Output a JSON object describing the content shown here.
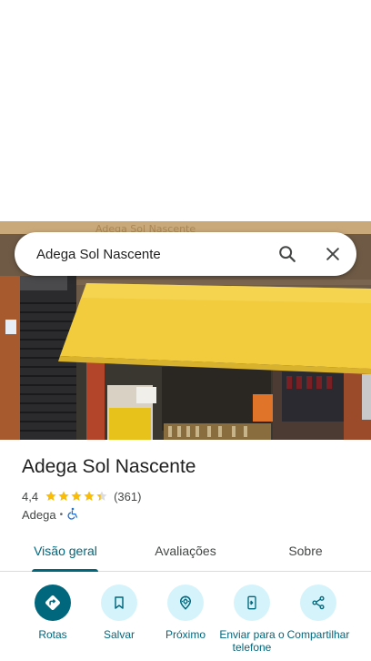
{
  "search": {
    "query": "Adega Sol Nascente"
  },
  "place": {
    "name": "Adega Sol Nascente",
    "rating": "4,4",
    "rating_value": 4.4,
    "rating_max": 5,
    "review_count": "(361)",
    "category": "Adega",
    "separator": "•",
    "accessibility_icon": "wheelchair-icon",
    "photo_sign_text": "Adega Sol Nascente"
  },
  "tabs": [
    {
      "label": "Visão geral",
      "active": true
    },
    {
      "label": "Avaliações",
      "active": false
    },
    {
      "label": "Sobre",
      "active": false
    }
  ],
  "actions": [
    {
      "label": "Rotas",
      "icon": "directions-icon"
    },
    {
      "label": "Salvar",
      "icon": "bookmark-icon"
    },
    {
      "label": "Próximo",
      "icon": "nearby-icon"
    },
    {
      "label": "Enviar para o telefone",
      "icon": "send-to-phone-icon"
    },
    {
      "label": "Compartilhar",
      "icon": "share-icon"
    }
  ],
  "colors": {
    "accent": "#00677d",
    "action_bg": "#d5f3fb",
    "star": "#fbbc04",
    "awning": "#f2cc3c",
    "text": "#1f1f1f",
    "muted_text": "#444746"
  }
}
